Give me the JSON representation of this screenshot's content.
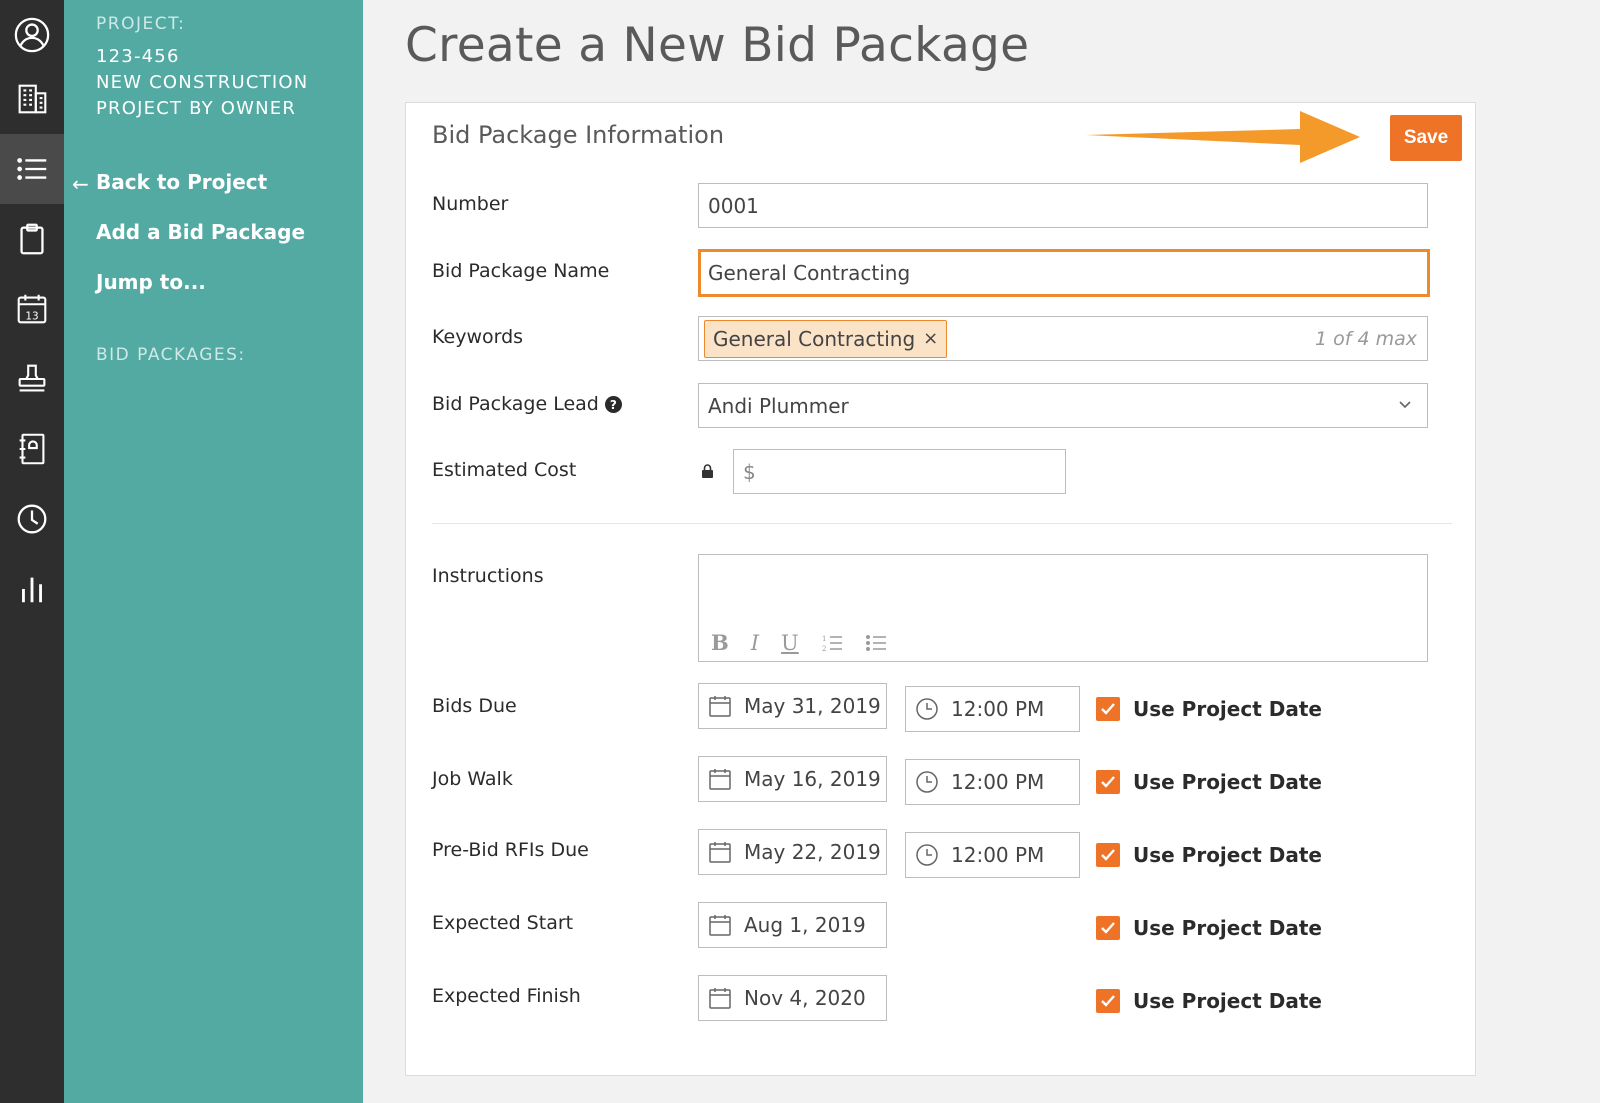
{
  "sidebar": {
    "project_label": "PROJECT:",
    "project_number": "123-456",
    "project_name_line1": "NEW CONSTRUCTION",
    "project_name_line2": "PROJECT BY OWNER",
    "back_arrow": "←",
    "back_label": "Back to Project",
    "add_label": "Add a Bid Package",
    "jump_label": "Jump to...",
    "bid_packages_label": "BID PACKAGES:"
  },
  "rail": {
    "icons": [
      "user-icon",
      "building-icon",
      "list-icon",
      "clipboard-icon",
      "calendar-icon",
      "stamp-icon",
      "contacts-icon",
      "clock-icon",
      "chart-icon"
    ],
    "active": "list-icon",
    "calendar_day": "13"
  },
  "page": {
    "title": "Create a New Bid Package"
  },
  "card": {
    "title": "Bid Package Information",
    "save_label": "Save"
  },
  "form": {
    "number": {
      "label": "Number",
      "value": "0001"
    },
    "name": {
      "label": "Bid Package Name",
      "value": "General Contracting"
    },
    "keywords": {
      "label": "Keywords",
      "tag": "General Contracting",
      "remove": "×",
      "count_note": "1 of 4 max"
    },
    "lead": {
      "label": "Bid Package Lead",
      "help": "?",
      "value": "Andi Plummer"
    },
    "cost": {
      "label": "Estimated Cost",
      "placeholder": "$"
    },
    "instructions": {
      "label": "Instructions",
      "tools": [
        "B",
        "I",
        "U"
      ]
    },
    "dates": [
      {
        "label": "Bids Due",
        "date": "May 31, 2019",
        "time": "12:00 PM",
        "use_project": "Use Project Date",
        "checked": true
      },
      {
        "label": "Job Walk",
        "date": "May 16, 2019",
        "time": "12:00 PM",
        "use_project": "Use Project Date",
        "checked": true
      },
      {
        "label": "Pre-Bid RFIs Due",
        "date": "May 22, 2019",
        "time": "12:00 PM",
        "use_project": "Use Project Date",
        "checked": true
      },
      {
        "label": "Expected Start",
        "date": "Aug 1, 2019",
        "use_project": "Use Project Date",
        "checked": true
      },
      {
        "label": "Expected Finish",
        "date": "Nov 4, 2020",
        "use_project": "Use Project Date",
        "checked": true
      }
    ]
  },
  "colors": {
    "accent": "#ee7326",
    "sidebar": "#52aaa3",
    "rail": "#2e2e2e",
    "focus": "#ee8a2e",
    "callout_arrow": "#f39a2b"
  }
}
